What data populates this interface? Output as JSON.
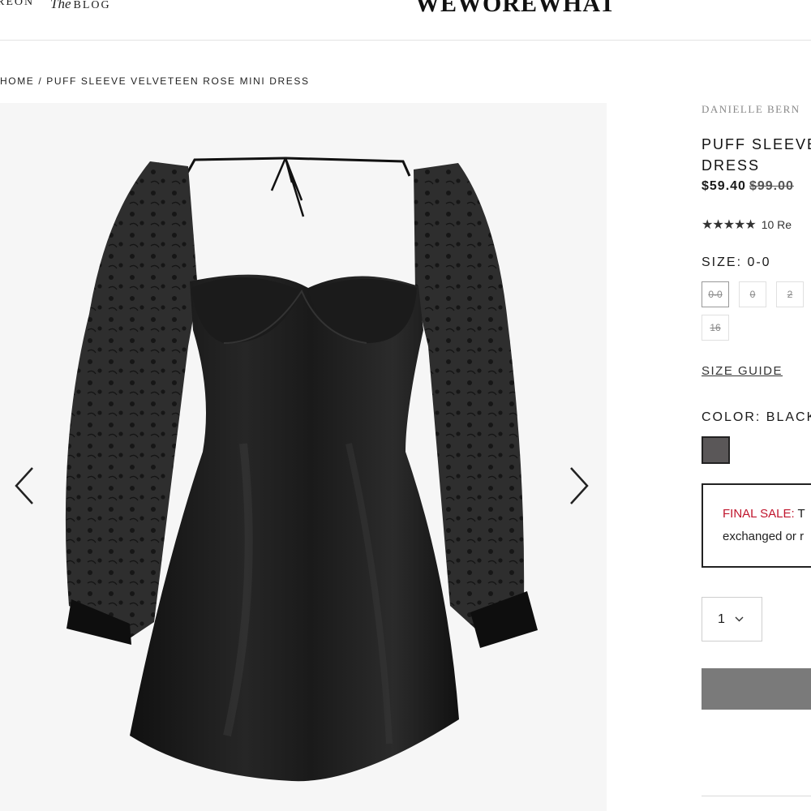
{
  "header": {
    "nav_patreon": "REON",
    "nav_blog_the": "The",
    "nav_blog": "BLOG",
    "logo": "WEWOREWHAT"
  },
  "breadcrumb": {
    "home": "HOME",
    "separator": "/",
    "current": "PUFF SLEEVE VELVETEEN ROSE MINI DRESS"
  },
  "gallery": {
    "prev_icon": "chevron-left-icon",
    "next_icon": "chevron-right-icon",
    "image": "black puff sleeve mini dress"
  },
  "product": {
    "brand": "DANIELLE BERN",
    "title_line1": "PUFF SLEEVE",
    "title_line2": "DRESS",
    "price": "$59.40",
    "compare_price": "$99.00",
    "rating_stars": "★★★★★",
    "rating_value": 5,
    "reviews": "10 Re"
  },
  "size": {
    "label": "SIZE: 0-0",
    "options": [
      "0-0",
      "0",
      "2",
      "16"
    ],
    "selected": "0-0",
    "guide": "SIZE GUIDE"
  },
  "color": {
    "label": "COLOR: BLACK",
    "swatch": "#5a5758"
  },
  "notice": {
    "title": "FINAL SALE:",
    "line1_rest": " T",
    "line2": "exchanged or r"
  },
  "quantity": {
    "value": "1",
    "icon": "chevron-down-icon"
  },
  "colors": {
    "sale_red": "#c0142c",
    "button_gray": "#7a7a7a"
  }
}
